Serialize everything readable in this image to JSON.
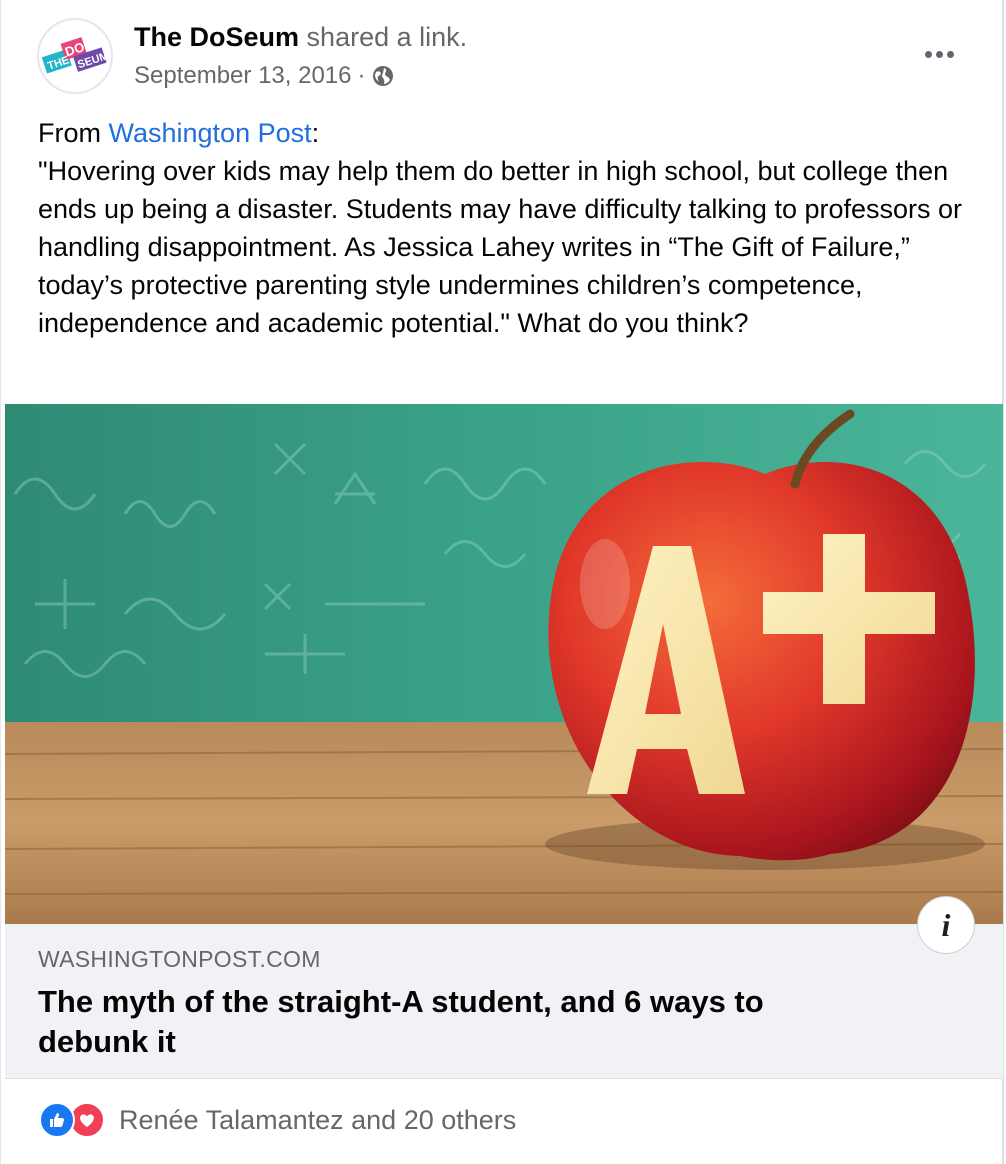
{
  "post": {
    "page_name": "The DoSeum",
    "action": "shared a link.",
    "date": "September 13, 2016",
    "separator": "·",
    "privacy_icon": "globe-icon",
    "more_icon": "more-options-icon",
    "text_prefix": "From ",
    "source_link": "Washington Post",
    "source_suffix": ":",
    "quote": "\"Hovering over kids may help them do better in high school, but college then ends up being a disaster. Students may have difficulty talking to professors or handling disappointment. As Jessica Lahey writes in “The Gift of Failure,” today’s protective parenting style undermines children’s competence, independence and academic potential.\" What do you think?"
  },
  "avatar": {
    "logo_text": [
      "THE",
      "DO",
      "SEUM"
    ]
  },
  "link_preview": {
    "image_description_icon": "apple-a-plus-image",
    "info_icon": "info-icon",
    "info_label": "i",
    "domain": "WASHINGTONPOST.COM",
    "headline": "The myth of the straight-A student, and 6 ways to debunk it"
  },
  "reactions": {
    "icons": [
      "like-icon",
      "love-icon"
    ],
    "summary": "Renée Talamantez and 20 others",
    "colors": {
      "like": "#1877f2",
      "love": "#f33e58"
    }
  },
  "colors": {
    "link": "#216fdb",
    "secondary_text": "#65676b",
    "meta_background": "#f0f2f5"
  }
}
